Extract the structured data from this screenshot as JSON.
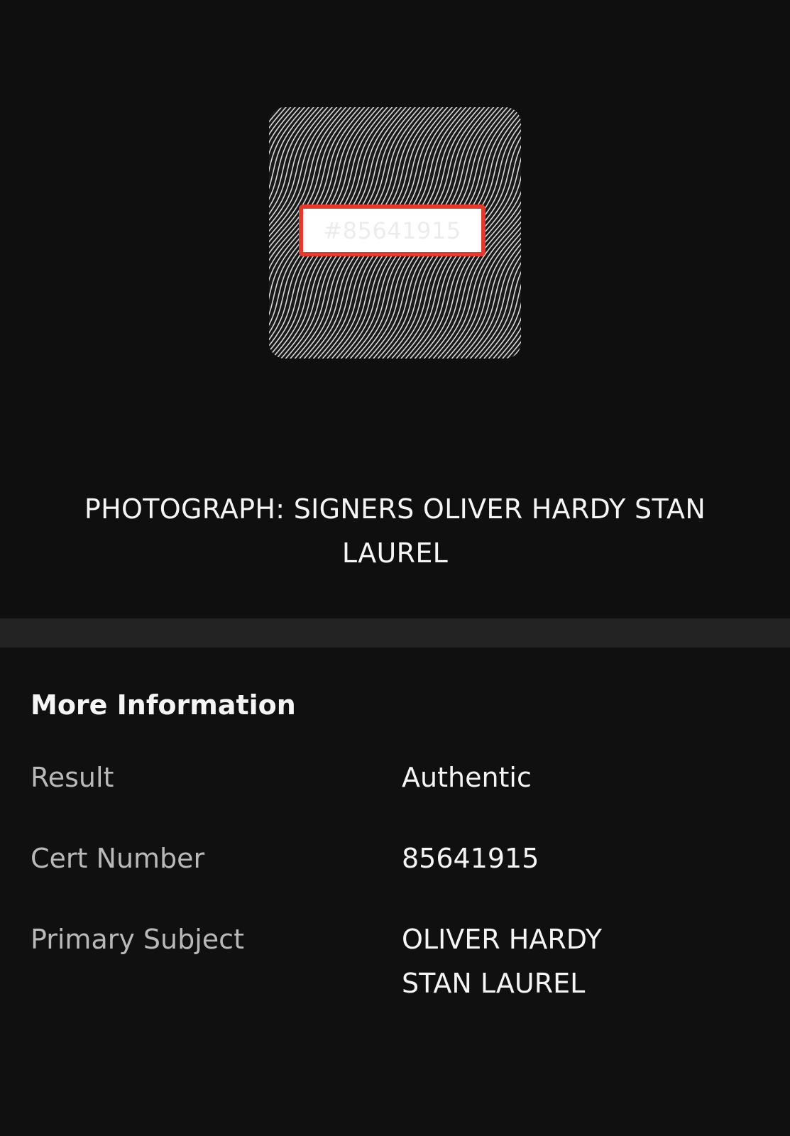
{
  "certificate": {
    "number_label": "#85641915",
    "colors": {
      "label_border": "#e23a2e",
      "pattern_light": "#d9d9d9",
      "pattern_dark": "#1a1a1a"
    }
  },
  "item": {
    "title": "PHOTOGRAPH: SIGNERS OLIVER HARDY STAN LAUREL"
  },
  "more_info": {
    "heading": "More Information",
    "rows": [
      {
        "label": "Result",
        "value_lines": [
          "Authentic"
        ]
      },
      {
        "label": "Cert Number",
        "value_lines": [
          "85641915"
        ]
      },
      {
        "label": "Primary Subject",
        "value_lines": [
          "OLIVER HARDY",
          "STAN LAUREL"
        ]
      }
    ]
  },
  "theme": {
    "background": "#101010",
    "divider": "#232323",
    "text_primary": "#f5f5f5",
    "text_secondary": "#b9b9b9"
  }
}
